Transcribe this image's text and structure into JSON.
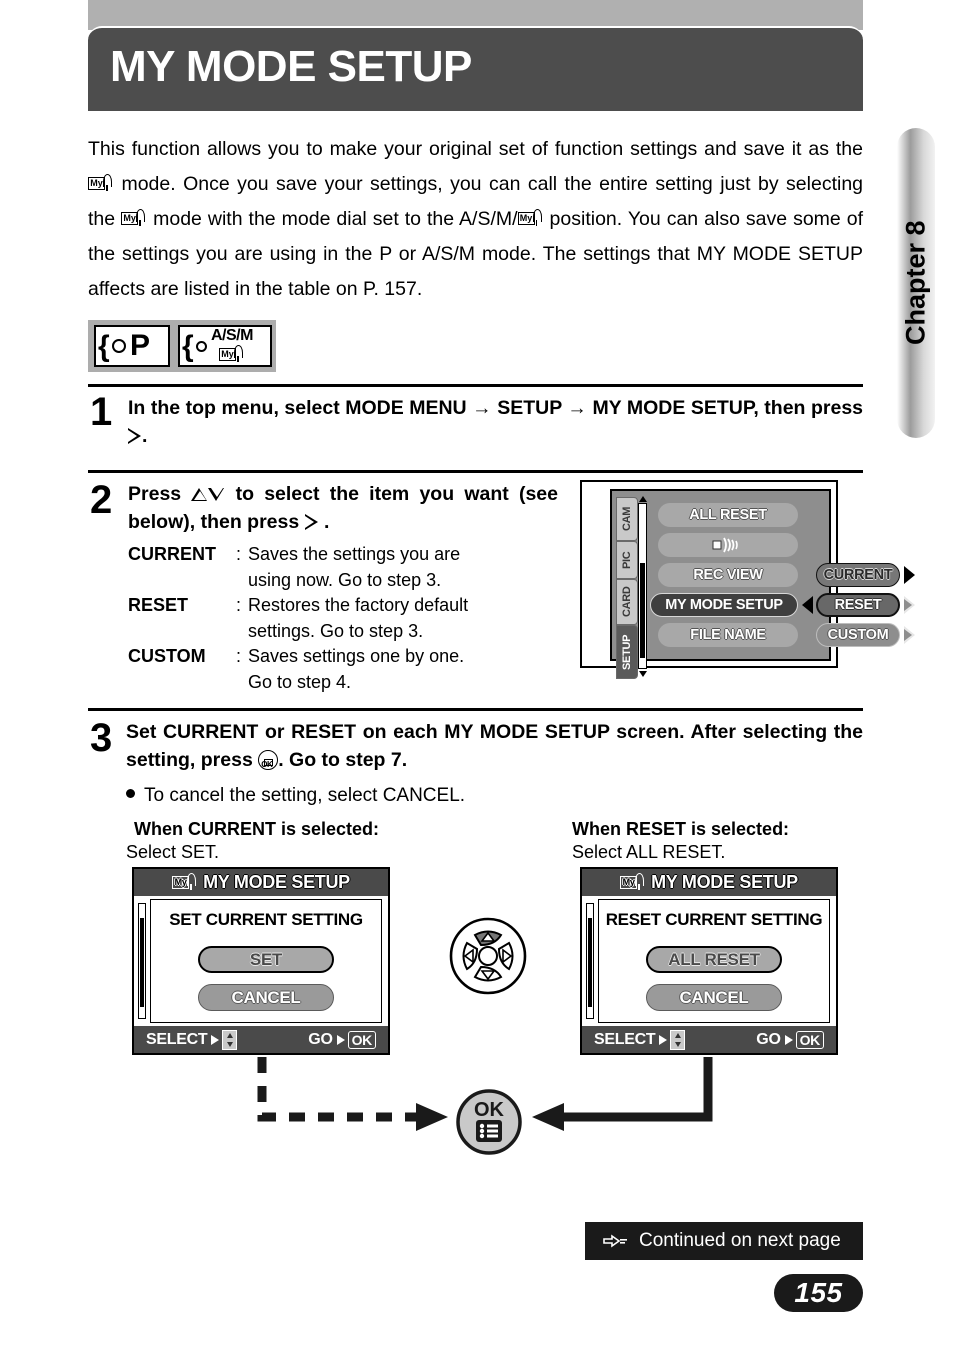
{
  "header": {
    "title": "MY MODE SETUP",
    "chapter_tab": "Chapter 8"
  },
  "intro": {
    "part1": "This function allows you to make your original set of function settings and save it as the",
    "part2": "mode. Once you save your settings, you can call the entire setting just by selecting the",
    "part3": "mode with the mode dial set to the A/S/M/",
    "part4": "position. You can also save some of the settings you are using in the P or A/S/M mode. The settings that MY MODE SETUP affects are listed in the table on P. 157.",
    "mymode_icon_label": "My"
  },
  "mode_dial": {
    "chip1_label": "P",
    "chip2_line1": "A/S/M",
    "chip2_icon_label": "My"
  },
  "steps": [
    {
      "number": "1",
      "text_a": "In the top menu, select MODE MENU",
      "arrow": "→",
      "text_b": "SETUP",
      "text_c": "MY MODE SETUP, then press",
      "text_d": "."
    },
    {
      "number": "2",
      "text_a": "Press",
      "text_b": "to select the item you want (see below), then press",
      "text_c": ".",
      "definitions": [
        {
          "term": "CURRENT",
          "colon": ":",
          "desc": "Saves the settings you are",
          "cont": "using now. Go to step 3."
        },
        {
          "term": "RESET",
          "colon": ":",
          "desc": "Restores the factory default",
          "cont": "settings. Go to step 3."
        },
        {
          "term": "CUSTOM",
          "colon": ":",
          "desc": "Saves settings one by one.",
          "cont": "Go to step 4."
        }
      ]
    },
    {
      "number": "3",
      "text_a": "Set CURRENT or RESET on each MY MODE SETUP screen. After selecting the setting, press",
      "text_b": ". Go to step 7.",
      "bullet": "To cancel the setting, select CANCEL."
    }
  ],
  "menu_screen": {
    "tabs": [
      {
        "label": "CAM",
        "selected": false
      },
      {
        "label": "PIC",
        "selected": false
      },
      {
        "label": "CARD",
        "selected": false
      },
      {
        "label": "SETUP",
        "selected": true
      }
    ],
    "items": [
      {
        "label": "ALL RESET",
        "selected": false
      },
      {
        "label": "",
        "icon": "speaker-icon",
        "selected": false
      },
      {
        "label": "REC VIEW",
        "selected": false
      },
      {
        "label": "MY MODE SETUP",
        "selected": true
      },
      {
        "label": "FILE NAME",
        "selected": false
      }
    ],
    "options": [
      {
        "label": "CURRENT",
        "state": "highlight"
      },
      {
        "label": "RESET",
        "state": "selected"
      },
      {
        "label": "CUSTOM",
        "state": "outline"
      }
    ]
  },
  "columns": {
    "left_heading": "When CURRENT is selected:",
    "left_sub": "Select SET.",
    "right_heading": "When RESET is selected:",
    "right_sub": "Select ALL RESET."
  },
  "dialog_left": {
    "title": "MY MODE SETUP",
    "heading": "SET CURRENT SETTING",
    "primary_button": "SET",
    "secondary_button": "CANCEL",
    "foot_left": "SELECT",
    "foot_right": "GO",
    "ok_label": "OK"
  },
  "dialog_right": {
    "title": "MY MODE SETUP",
    "heading": "RESET CURRENT SETTING",
    "primary_button": "ALL RESET",
    "secondary_button": "CANCEL",
    "foot_left": "SELECT",
    "foot_right": "GO",
    "ok_label": "OK"
  },
  "ok_button": {
    "label": "OK",
    "icon": "menu-list-icon"
  },
  "footer": {
    "continued": "Continued on next page",
    "page_number": "155"
  },
  "colors": {
    "header_bg": "#4d4d4d",
    "top_strip": "#b0b0b0",
    "lcd_bg": "#8e8e8e",
    "footer_bg": "#1a1a1a",
    "selected_pill": "#3f3f3f"
  }
}
